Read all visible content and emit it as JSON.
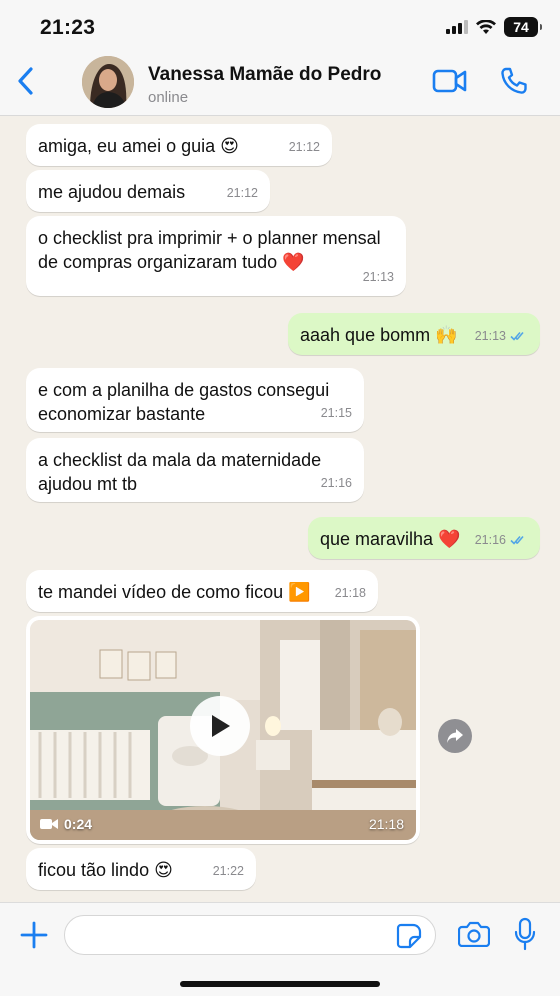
{
  "status_bar": {
    "time": "21:23",
    "battery": "74"
  },
  "header": {
    "contact_name": "Vanessa Mamãe do Pedro",
    "status": "online"
  },
  "messages": [
    {
      "dir": "in",
      "text": "amiga, eu amei o guia 😍",
      "time": "21:12"
    },
    {
      "dir": "in",
      "text": "me ajudou demais",
      "time": "21:12"
    },
    {
      "dir": "in",
      "text": "o checklist pra imprimir + o planner mensal de compras organizaram tudo ❤️",
      "time": "21:13"
    },
    {
      "dir": "out",
      "text": "aaah que bomm 🙌",
      "time": "21:13"
    },
    {
      "dir": "in",
      "text": "e com a planilha de gastos consegui economizar bastante",
      "time": "21:15"
    },
    {
      "dir": "in",
      "text": "a checklist da mala da maternidade ajudou mt tb",
      "time": "21:16"
    },
    {
      "dir": "out",
      "text": "que maravilha ❤️",
      "time": "21:16"
    },
    {
      "dir": "in",
      "text": "te mandei vídeo de como ficou ▶️",
      "time": "21:18"
    },
    {
      "dir": "in",
      "text": "ficou tão lindo 😍",
      "time": "21:22"
    }
  ],
  "video": {
    "duration": "0:24",
    "time": "21:18"
  },
  "composer": {
    "placeholder": ""
  },
  "icons": {
    "back": "chevron-left-icon",
    "video_call": "video-camera-icon",
    "voice_call": "phone-icon",
    "play": "play-icon",
    "forward": "forward-icon",
    "plus": "plus-icon",
    "sticker": "sticker-icon",
    "camera": "camera-icon",
    "mic": "microphone-icon"
  },
  "colors": {
    "accent_blue": "#1a7ef0",
    "outgoing_bubble": "#dcf8c6",
    "incoming_bubble": "#ffffff",
    "read_ticks": "#53a6e6",
    "chat_background": "#f3efe8"
  }
}
